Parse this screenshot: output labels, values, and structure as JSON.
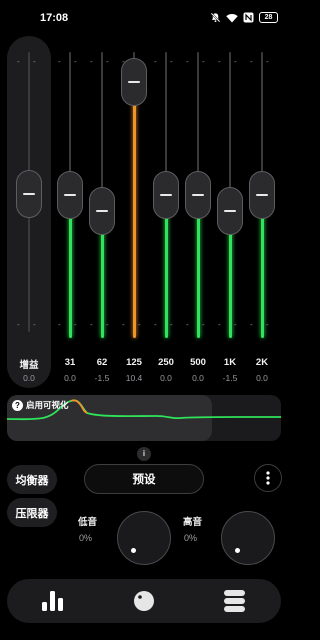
{
  "status": {
    "time": "17:08",
    "battery": "28"
  },
  "gain": {
    "label": "增益",
    "value": "0.0"
  },
  "bands": [
    {
      "label": "31",
      "value": "0.0",
      "level": 0.0,
      "color": "#2fe35a"
    },
    {
      "label": "62",
      "value": "-1.5",
      "level": -1.5,
      "color": "#2fe35a"
    },
    {
      "label": "125",
      "value": "10.4",
      "level": 10.4,
      "color": "#f0942a"
    },
    {
      "label": "250",
      "value": "0.0",
      "level": 0.0,
      "color": "#2fe35a"
    },
    {
      "label": "500",
      "value": "0.0",
      "level": 0.0,
      "color": "#2fe35a"
    },
    {
      "label": "1K",
      "value": "-1.5",
      "level": -1.5,
      "color": "#2fe35a"
    },
    {
      "label": "2K",
      "value": "0.0",
      "level": 0.0,
      "color": "#2fe35a"
    }
  ],
  "visualizer": {
    "label": "启用可视化",
    "help_icon": "?",
    "curve_color": "#2fe35a",
    "peak_color": "#f0942a"
  },
  "info_icon": "i",
  "equalizer_button": "均衡器",
  "limiter_button": "压限器",
  "preset_button": "预设",
  "bass": {
    "label": "低音",
    "value": "0%"
  },
  "treble": {
    "label": "高音",
    "value": "0%"
  },
  "nav": {
    "items": [
      "equalizer-bars-icon",
      "knob-icon",
      "layers-menu-icon"
    ]
  }
}
